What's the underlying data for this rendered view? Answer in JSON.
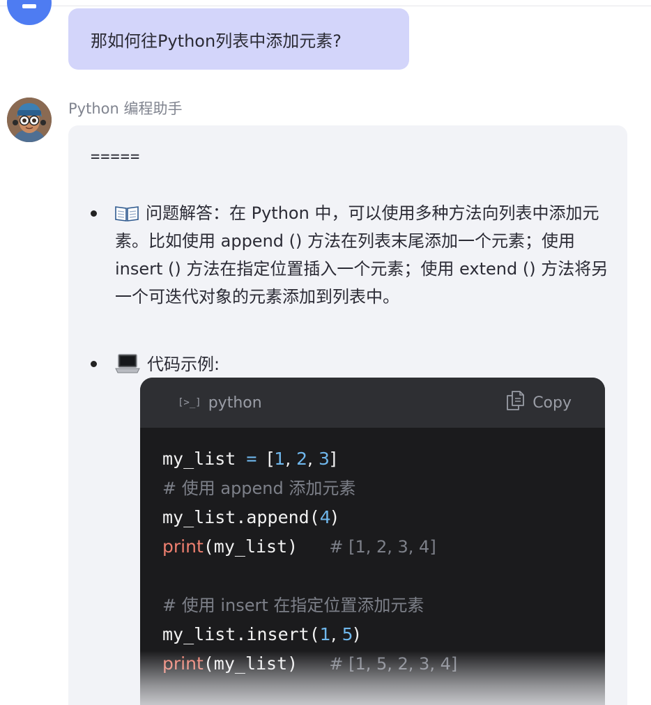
{
  "user_message": {
    "text": "那如何往Python列表中添加元素?"
  },
  "assistant": {
    "name": "Python 编程助手",
    "separator": "=====",
    "answer_prefix": "问题解答：",
    "answer_body": "在 Python 中，可以使用多种方法向列表中添加元素。比如使用 append () 方法在列表末尾添加一个元素；使用 insert () 方法在指定位置插入一个元素；使用 extend () 方法将另一个可迭代对象的元素添加到列表中。",
    "example_label": "代码示例:"
  },
  "code_block": {
    "language": "python",
    "copy_label": "Copy",
    "lines": {
      "l1": {
        "var": "my_list",
        "op": "=",
        "open": "[",
        "n1": "1",
        "sep1": ", ",
        "n2": "2",
        "sep2": ", ",
        "n3": "3",
        "close": "]"
      },
      "l2": {
        "comment": "# 使用 append 添加元素"
      },
      "l3": {
        "obj": "my_list.append(",
        "num": "4",
        "close": ")"
      },
      "l4": {
        "fn": "print",
        "args": "(my_list)",
        "comment": "# [1, 2, 3, 4]"
      },
      "l6": {
        "comment": "# 使用 insert 在指定位置添加元素"
      },
      "l7": {
        "obj": "my_list.insert(",
        "num1": "1",
        "sep": ", ",
        "num2": "5",
        "close": ")"
      },
      "l8": {
        "fn": "print",
        "args": "(my_list)",
        "comment": "# [1, 5, 2, 3, 4]"
      }
    }
  },
  "colors": {
    "user_bubble": "#d3d5fa",
    "assistant_bubble": "#f2f3f7",
    "code_background": "#1b1b1d",
    "code_header": "#2e2f33",
    "number": "#6fb7ec",
    "builtin_function": "#ee7f6f",
    "comment": "#7d8089"
  },
  "icons": {
    "answer_emoji": "open-book-icon",
    "example_emoji": "laptop-icon",
    "language_icon": "terminal-icon",
    "copy_icon": "copy-icon"
  }
}
